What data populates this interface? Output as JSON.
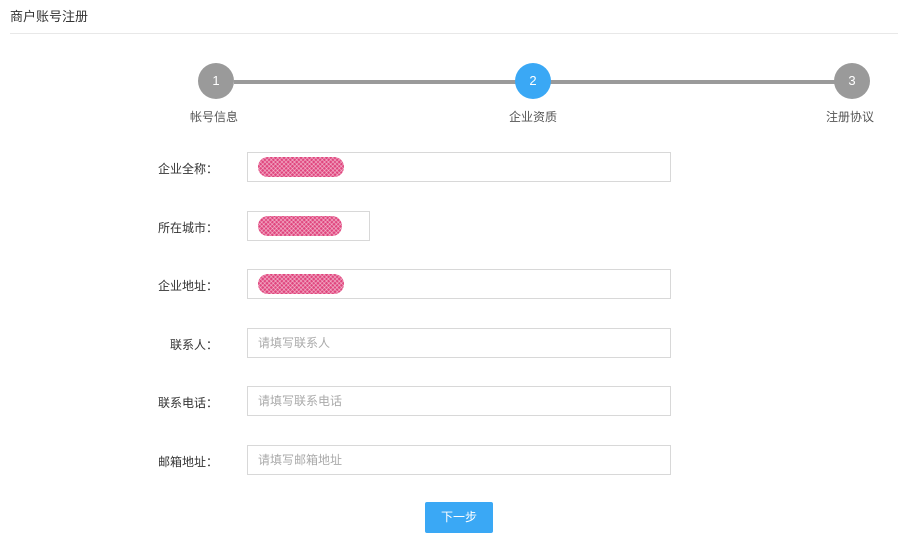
{
  "header": {
    "title": "商户账号注册"
  },
  "stepper": {
    "steps": [
      {
        "number": "1",
        "label": "帐号信息",
        "state": "done"
      },
      {
        "number": "2",
        "label": "企业资质",
        "state": "active"
      },
      {
        "number": "3",
        "label": "注册协议",
        "state": "pending"
      }
    ]
  },
  "form": {
    "company_name": {
      "label": "企业全称：",
      "value": ""
    },
    "city": {
      "label": "所在城市：",
      "value": ""
    },
    "address": {
      "label": "企业地址：",
      "value": ""
    },
    "contact": {
      "label": "联系人：",
      "placeholder": "请填写联系人"
    },
    "phone": {
      "label": "联系电话：",
      "placeholder": "请填写联系电话"
    },
    "email": {
      "label": "邮箱地址：",
      "placeholder": "请填写邮箱地址"
    },
    "next_label": "下一步"
  },
  "colors": {
    "accent": "#3aa8f5",
    "step_inactive": "#9a9a9a",
    "redaction": "#e0457e"
  }
}
